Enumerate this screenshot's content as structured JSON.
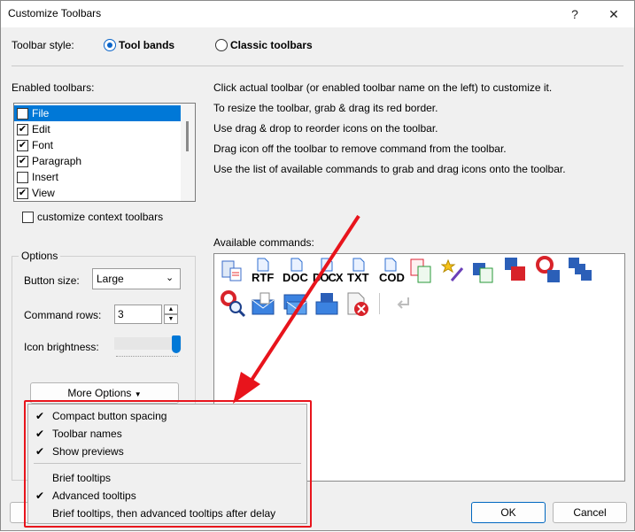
{
  "window": {
    "title": "Customize Toolbars",
    "help": "?",
    "close": "✕"
  },
  "style": {
    "label": "Toolbar style:",
    "opt1": "Tool bands",
    "opt2": "Classic toolbars"
  },
  "enabled": {
    "label": "Enabled toolbars:",
    "items": [
      {
        "label": "File",
        "checked": true,
        "selected": true
      },
      {
        "label": "Edit",
        "checked": true
      },
      {
        "label": "Font",
        "checked": true
      },
      {
        "label": "Paragraph",
        "checked": true
      },
      {
        "label": "Insert",
        "checked": false
      },
      {
        "label": "View",
        "checked": true
      }
    ]
  },
  "context": {
    "label": "customize context toolbars"
  },
  "help_lines": [
    "Click actual toolbar (or enabled toolbar name on the left) to customize it.",
    "To resize the toolbar, grab & drag its red border.",
    "Use drag & drop to reorder icons on the toolbar.",
    "Drag icon off the toolbar to remove command from the toolbar.",
    "Use the list of available commands to grab and drag icons onto the toolbar."
  ],
  "options": {
    "legend": "Options",
    "button_size_label": "Button size:",
    "button_size_value": "Large",
    "rows_label": "Command rows:",
    "rows_value": "3",
    "brightness_label": "Icon brightness:",
    "more_options": "More Options"
  },
  "commands": {
    "label": "Available commands:",
    "text_icons": [
      "RTF",
      "DOC",
      "DOCX",
      "TXT",
      "COD"
    ]
  },
  "menu": {
    "items": [
      {
        "label": "Compact button spacing",
        "checked": true
      },
      {
        "label": "Toolbar names",
        "checked": true
      },
      {
        "label": "Show previews",
        "checked": true
      },
      {
        "label": "Brief tooltips",
        "checked": false
      },
      {
        "label": "Advanced tooltips",
        "checked": true
      },
      {
        "label": "Brief tooltips, then advanced tooltips after delay",
        "checked": false
      }
    ]
  },
  "buttons": {
    "ok": "OK",
    "cancel": "Cancel"
  },
  "colors": {
    "accent": "#0078d7",
    "highlight": "#e8141c"
  }
}
